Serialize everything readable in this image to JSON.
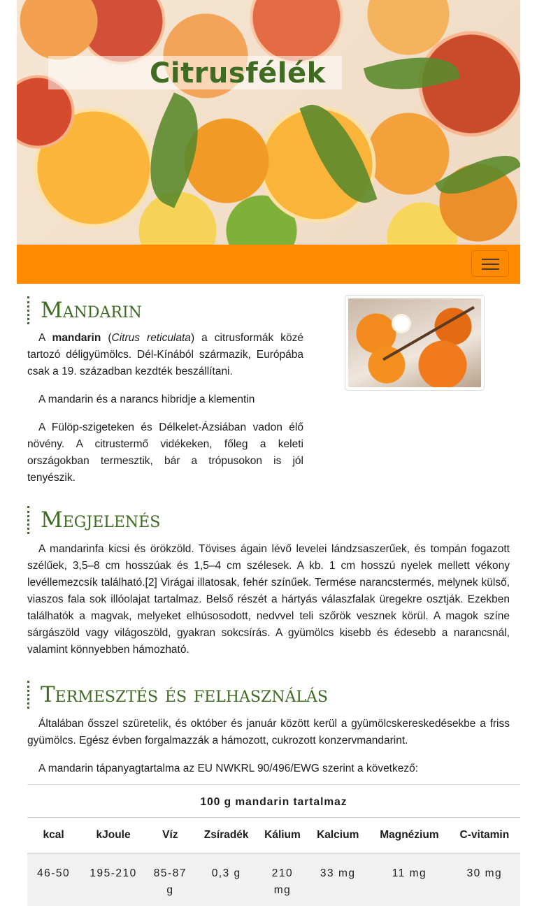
{
  "hero": {
    "title": "Citrusfélék"
  },
  "navbar": {
    "toggle_icon": "hamburger-icon",
    "color": "#ff8a00"
  },
  "sections": {
    "mandarin": {
      "heading": "Mandarin",
      "p1_pre": "A ",
      "p1_bold": "mandarin",
      "p1_mid": " (",
      "p1_italic": "Citrus reticulata",
      "p1_post": ") a citrusformák közé tartozó déligyümölcs. Dél-Kínából származik, Európába csak a 19. században kezdték beszállítani.",
      "p2": "A mandarin és a narancs hibridje a klementin",
      "p3": "A Fülöp-szigeteken és Délkelet-Ázsiában vadon élő növény. A citrustermő vidékeken, főleg a keleti országokban termesztik, bár a trópusokon is jól tenyészik."
    },
    "megjelenes": {
      "heading": "Megjelenés",
      "p1": "A mandarinfa kicsi és örökzöld. Tövises ágain lévő levelei lándzsaszerűek, és tompán fogazott szélűek, 3,5–8 cm hosszúak és 1,5–4 cm szélesek. A kb. 1 cm hosszú nyelek mellett vékony levéllemezcsík található.[2] Virágai illatosak, fehér színűek. Termése narancstermés, melynek külső, viaszos fala sok illóolajat tartalmaz. Belső részét a hártyás válaszfalak üregekre osztják. Ezekben találhatók a magvak, melyeket elhúsosodott, nedvvel teli szőrök vesznek körül. A magok színe sárgászöld vagy világoszöld, gyakran sokcsírás. A gyümölcs kisebb és édesebb a narancsnál, valamint könnyebben hámozható."
    },
    "termesztes": {
      "heading": "Termesztés és felhasználás",
      "p1": "Általában ősszel szüretelik, és október és január között kerül a gyümölcskereskedésekbe a friss gyümölcs. Egész évben forgalmazzák a hámozott, cukrozott konzervmandarint.",
      "p2": "A mandarin tápanyagtartalma az EU NWKRL 90/496/EWG szerint a következő:"
    }
  },
  "table": {
    "caption": "100 g mandarin tartalmaz",
    "headers": [
      "kcal",
      "kJoule",
      "Víz",
      "Zsíradék",
      "Kálium",
      "Kalcium",
      "Magnézium",
      "C-vitamin"
    ],
    "row": [
      "46-50",
      "195-210",
      "85-87 g",
      "0,3 g",
      "210 mg",
      "33 mg",
      "11 mg",
      "30 mg"
    ]
  }
}
